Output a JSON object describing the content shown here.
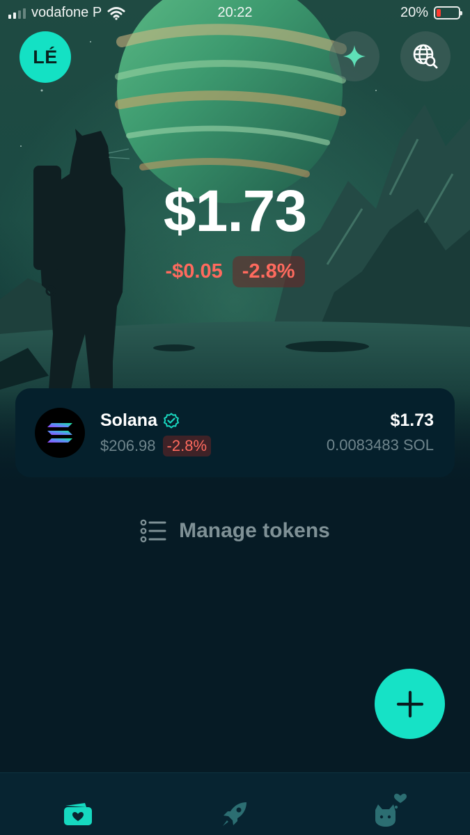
{
  "status_bar": {
    "carrier": "vodafone P",
    "time": "20:22",
    "battery_percent_label": "20%",
    "battery_level": 0.2
  },
  "header": {
    "avatar_initials": "LÉ",
    "sparkle_icon": "sparkle-icon",
    "explore_icon": "globe-search-icon"
  },
  "portfolio": {
    "balance": "$1.73",
    "change_amount": "-$0.05",
    "change_percent": "-2.8%"
  },
  "tokens": [
    {
      "name": "Solana",
      "verified": true,
      "price": "$206.98",
      "change_percent": "-2.8%",
      "value": "$1.73",
      "amount": "0.0083483 SOL"
    }
  ],
  "manage_tokens": {
    "label": "Manage tokens"
  },
  "fab": {
    "icon": "plus-icon"
  },
  "bottom_nav": {
    "items": [
      {
        "icon": "wallet-icon",
        "active": true
      },
      {
        "icon": "rocket-icon",
        "active": false
      },
      {
        "icon": "cat-heart-icon",
        "active": false
      }
    ]
  },
  "colors": {
    "accent": "#14e1c4",
    "background": "#061b25",
    "negative": "#ff6a5e",
    "muted_text": "#6f858c"
  }
}
